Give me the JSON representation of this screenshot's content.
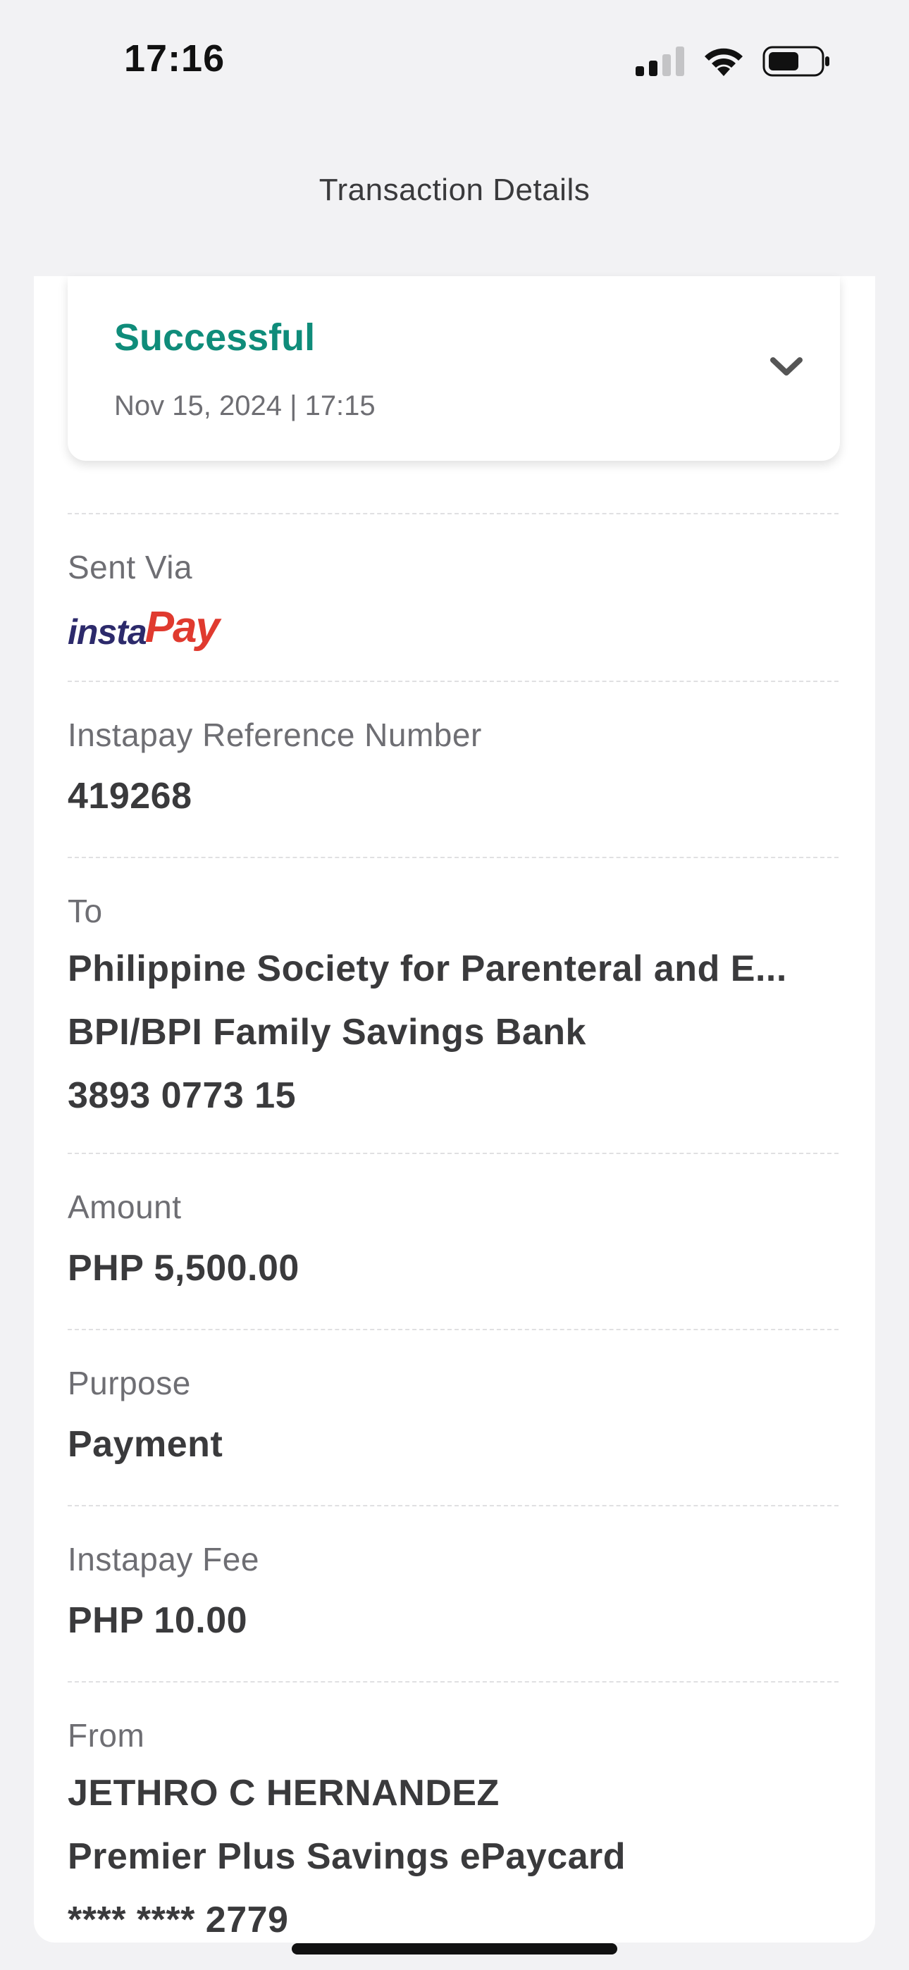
{
  "status_bar": {
    "time": "17:16",
    "icons": [
      "signal-icon",
      "wifi-icon",
      "battery-icon"
    ]
  },
  "header": {
    "title": "Transaction Details"
  },
  "status": {
    "label": "Successful",
    "datetime": "Nov 15, 2024 | 17:15",
    "accent_color": "#0f8c7a"
  },
  "sent_via": {
    "label": "Sent Via",
    "logo_text_1": "insta",
    "logo_text_2": "Pay"
  },
  "reference": {
    "label": "Instapay Reference Number",
    "value": "419268"
  },
  "to": {
    "label": "To",
    "name": "Philippine Society for Parenteral and E...",
    "bank": "BPI/BPI Family Savings Bank",
    "account": "3893 0773 15"
  },
  "amount": {
    "label": "Amount",
    "value": "PHP 5,500.00"
  },
  "purpose": {
    "label": "Purpose",
    "value": "Payment"
  },
  "fee": {
    "label": "Instapay Fee",
    "value": "PHP 10.00"
  },
  "from": {
    "label": "From",
    "name": "JETHRO C HERNANDEZ",
    "account_type": "Premier Plus Savings ePaycard",
    "account": "**** **** 2779"
  }
}
